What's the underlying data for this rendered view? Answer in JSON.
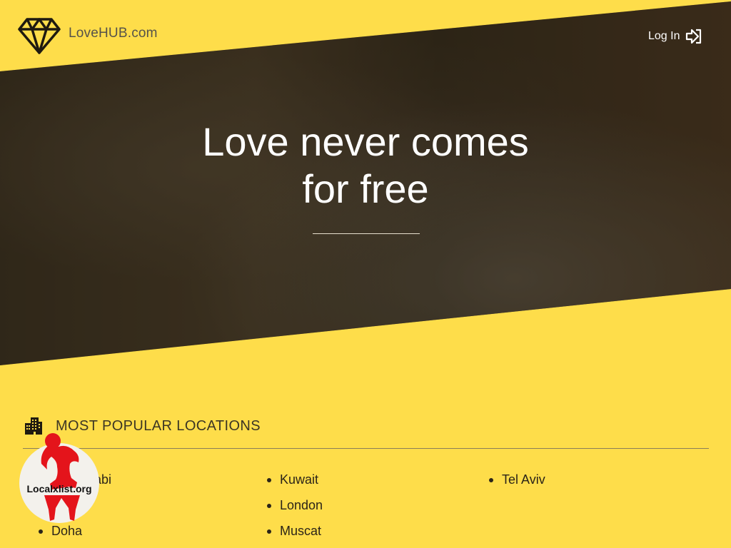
{
  "header": {
    "brand": "LoveHUB.com",
    "logo_icon": "diamond-icon",
    "login_label": "Log In",
    "login_icon": "sign-in-icon"
  },
  "hero": {
    "title_line1": "Love never comes",
    "title_line2": "for free"
  },
  "locations": {
    "section_icon": "building-icon",
    "title": "MOST POPULAR LOCATIONS",
    "columns": [
      [
        "Abu Dhabi",
        "",
        "Doha"
      ],
      [
        "Kuwait",
        "London",
        "Muscat"
      ],
      [
        "Tel Aviv"
      ]
    ]
  },
  "watermark": {
    "text": "Localxlist.org"
  },
  "colors": {
    "background": "#fedd4a",
    "hero_text": "#ffffff",
    "watermark_red": "#e4141b"
  }
}
